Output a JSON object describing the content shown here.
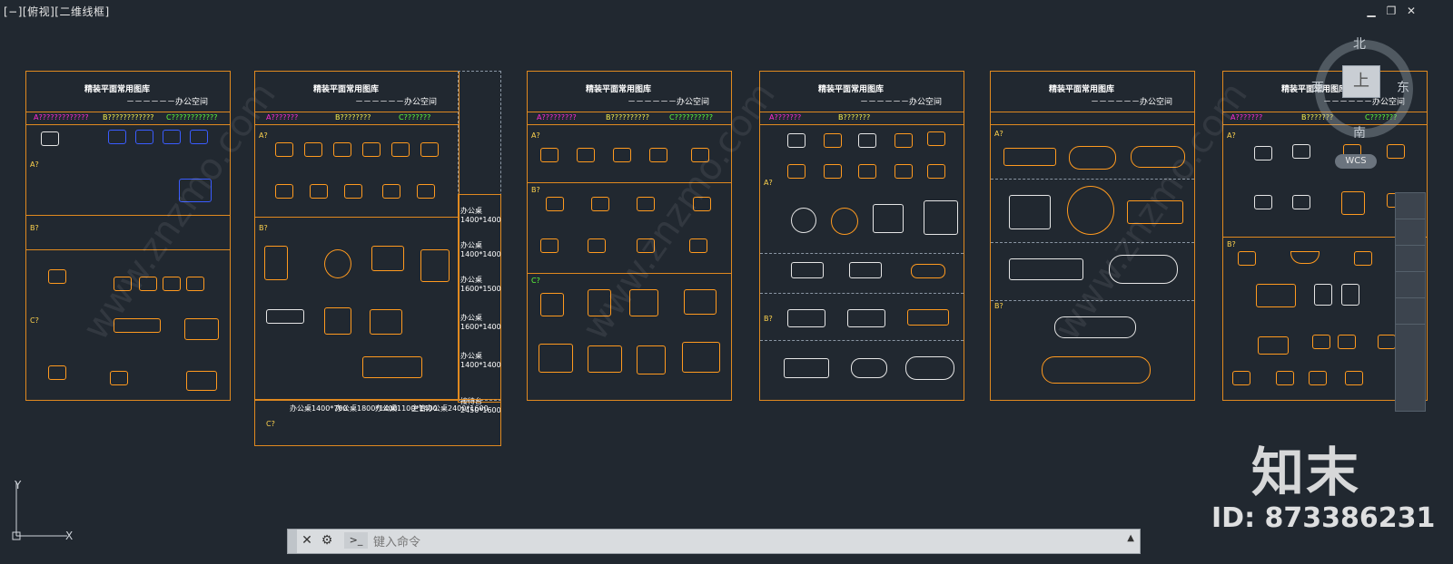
{
  "viewport": {
    "label": "[−][俯视][二维线框]"
  },
  "window_controls": [
    "minimize",
    "restore",
    "close"
  ],
  "sheets": [
    {
      "title": "精装平面常用图库",
      "subtitle": "－－－－－－办公空间",
      "legend": [
        "A?????????????",
        "B????????????",
        "C????????????"
      ],
      "categories": [
        "A?",
        "B?",
        "C?"
      ]
    },
    {
      "title": "精装平面常用图库",
      "subtitle": "－－－－－－办公空间",
      "legend": [
        "A???????",
        "B????????",
        "C???????"
      ],
      "categories": [
        "A?",
        "B?",
        "C?"
      ]
    },
    {
      "title": "精装平面常用图库",
      "subtitle": "－－－－－－办公空间",
      "legend": [
        "A?????????",
        "B??????????",
        "C??????????"
      ],
      "categories": [
        "A?",
        "B?",
        "C?"
      ]
    },
    {
      "title": "精装平面常用图库",
      "subtitle": "－－－－－－办公空间",
      "legend": [
        "A???????",
        "B???????"
      ],
      "categories": [
        "A?",
        "B?"
      ]
    },
    {
      "title": "精装平面常用图库",
      "subtitle": "－－－－－－办公空间",
      "legend": [],
      "categories": [
        "A?",
        "B?"
      ]
    },
    {
      "title": "精装平面常用图库",
      "subtitle": "－－－－－－办公空间",
      "legend": [
        "A???????",
        "B???????",
        "C???????"
      ],
      "categories": [
        "A?",
        "B?"
      ]
    }
  ],
  "side_table": {
    "rows": [
      "办公桌1400*1400",
      "办公桌1400*1400",
      "办公桌1600*1500",
      "办公桌1600*1400",
      "办公桌1400*1400",
      "接待台2450*1600"
    ],
    "bottom_row": [
      "办公桌1400*700",
      "办公桌1800*1400",
      "办公桌1100*1400",
      "主管办公桌2400*1600"
    ]
  },
  "compass": {
    "north": "北",
    "south": "南",
    "east": "东",
    "west": "西",
    "top": "上",
    "wcs": "WCS"
  },
  "command_line": {
    "placeholder": "键入命令",
    "prompt_icon": ">_"
  },
  "watermark": {
    "logo": "知末",
    "id": "ID: 873386231",
    "diagonal": "www.znzmo.com"
  }
}
